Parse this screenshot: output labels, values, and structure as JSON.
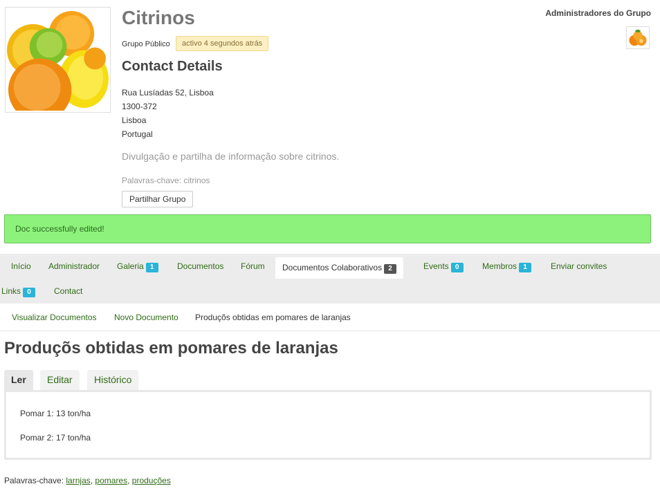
{
  "group": {
    "title": "Citrinos",
    "type": "Grupo Público",
    "activity": "activo 4 segundos atrás",
    "contact_title": "Contact Details",
    "address": [
      "Rua Lusíadas 52, Lisboa",
      "1300-372",
      "Lisboa",
      "Portugal"
    ],
    "description": "Divulgação e partilha de informação sobre citrinos.",
    "keywords": "Palavras-chave: citrinos",
    "share_label": "Partilhar Grupo",
    "admins_title": "Administradores do Grupo"
  },
  "alert": {
    "message": "Doc successfully edited!"
  },
  "nav": {
    "items": [
      {
        "label": "Início"
      },
      {
        "label": "Administrador"
      },
      {
        "label": "Galeria",
        "badge": "1"
      },
      {
        "label": "Documentos"
      },
      {
        "label": "Fórum"
      },
      {
        "label": "Documentos Colaborativos",
        "badge": "2"
      },
      {
        "label": "Events",
        "badge": "0"
      },
      {
        "label": "Membros",
        "badge": "1"
      },
      {
        "label": "Enviar convites"
      },
      {
        "label": "Links",
        "badge": "0"
      },
      {
        "label": "Contact"
      }
    ]
  },
  "subnav": {
    "items": [
      {
        "label": "Visualizar Documentos"
      },
      {
        "label": "Novo Documento"
      },
      {
        "label": "Produçõs obtidas em pomares de laranjas"
      }
    ]
  },
  "document": {
    "title": "Produçõs obtidas em pomares de laranjas",
    "tabs": [
      {
        "label": "Ler"
      },
      {
        "label": "Editar"
      },
      {
        "label": "Histórico"
      }
    ],
    "lines": [
      "Pomar 1: 13 ton/ha",
      "Pomar 2: 17 ton/ha"
    ],
    "keywords_label": "Palavras-chave:",
    "keywords": [
      "larnjas",
      "pomares",
      "produções"
    ]
  },
  "colors": {
    "link": "#2f6b16",
    "alert_bg": "#8df27b",
    "badge": "#2ab4d8",
    "nav_bg": "#ececec"
  },
  "icons": {
    "group_avatar": "citrus-fruit-image",
    "admin_avatar": "orange-fruit-avatar"
  }
}
